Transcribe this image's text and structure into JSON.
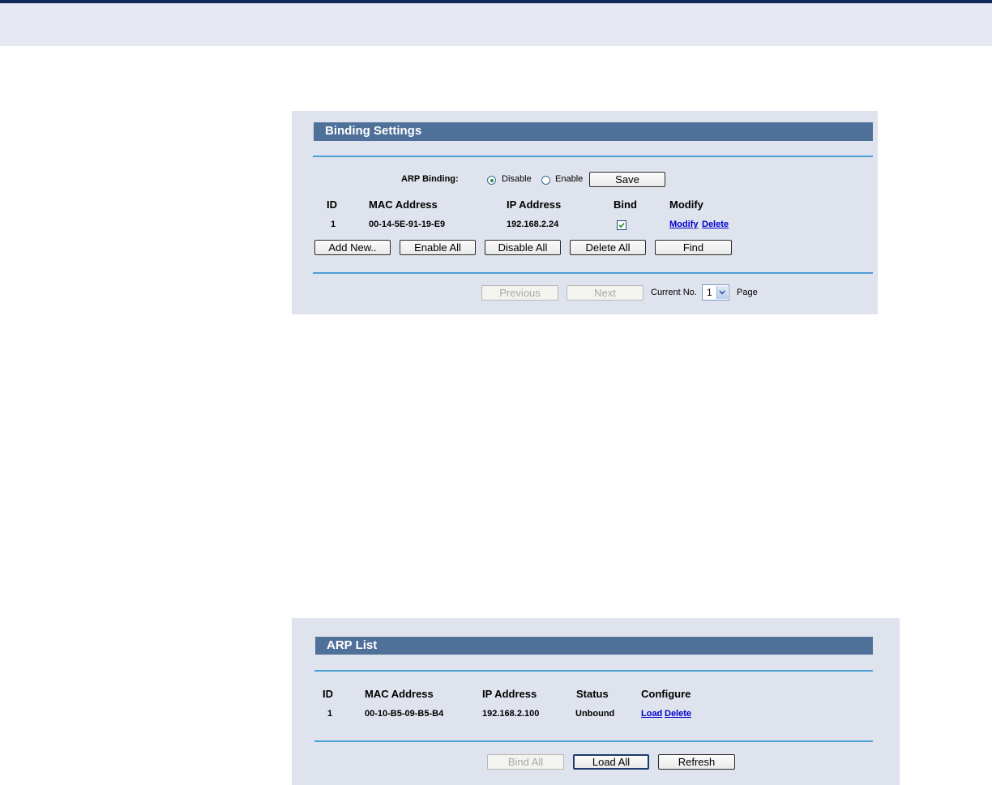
{
  "binding_settings": {
    "title": "Binding Settings",
    "arp_binding_label": "ARP Binding:",
    "option_disable": "Disable",
    "option_enable": "Enable",
    "selected": "Disable",
    "save_label": "Save",
    "columns": [
      "ID",
      "MAC Address",
      "IP Address",
      "Bind",
      "Modify"
    ],
    "rows": [
      {
        "id": "1",
        "mac": "00-14-5E-91-19-E9",
        "ip": "192.168.2.24",
        "bind": true,
        "modify_label": "Modify",
        "delete_label": "Delete"
      }
    ],
    "buttons": {
      "add_new": "Add New..",
      "enable_all": "Enable All",
      "disable_all": "Disable All",
      "delete_all": "Delete All",
      "find": "Find"
    },
    "pager": {
      "previous": "Previous",
      "next": "Next",
      "current_label": "Current No.",
      "current_value": "1",
      "page_label": "Page"
    }
  },
  "arp_list": {
    "title": "ARP List",
    "columns": [
      "ID",
      "MAC Address",
      "IP Address",
      "Status",
      "Configure"
    ],
    "rows": [
      {
        "id": "1",
        "mac": "00-10-B5-09-B5-B4",
        "ip": "192.168.2.100",
        "status": "Unbound",
        "load_label": "Load",
        "delete_label": "Delete"
      }
    ],
    "buttons": {
      "bind_all": "Bind All",
      "load_all": "Load All",
      "refresh": "Refresh"
    }
  },
  "colors": {
    "header_bar": "#4f7199",
    "panel_bg": "#dfe3ed",
    "rule": "#4a9fd6",
    "top_band": "#e6e9f1",
    "top_border": "#13295a",
    "link": "#0000cc"
  }
}
